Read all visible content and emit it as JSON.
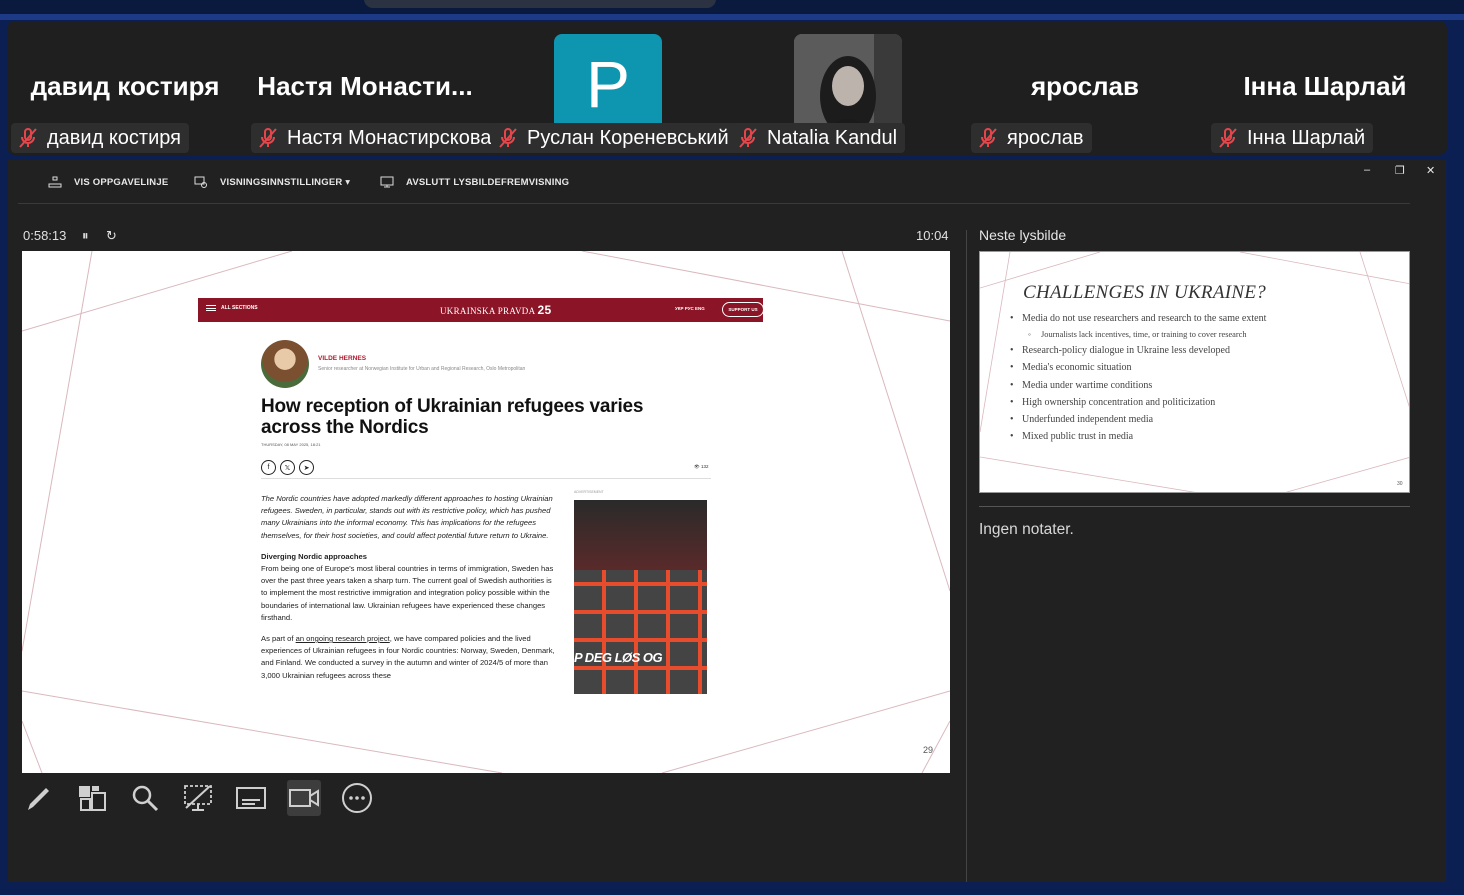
{
  "participants": [
    {
      "big_name": "давид костиря",
      "label": "давид костиря",
      "muted": true
    },
    {
      "big_name": "Настя  Монасти...",
      "label": "Настя Монастирскова",
      "muted": true
    },
    {
      "avatar_letter": "P",
      "label": "Руслан Кореневський",
      "muted": true
    },
    {
      "label": "Natalia Kandul",
      "muted": true,
      "has_video": true
    },
    {
      "big_name": "ярослав",
      "label": "ярослав",
      "muted": true
    },
    {
      "big_name": "Інна Шарлай",
      "label": "Інна Шарлай",
      "muted": true
    }
  ],
  "toolbar": {
    "show_taskbar": "VIS OPPGAVELINJE",
    "display_settings": "VISNINGSINNSTILLINGER ▾",
    "end_slideshow": "AVSLUTT LYSBILDEFREMVISNING",
    "win_min": "–",
    "win_restore": "❐",
    "win_close": "✕"
  },
  "presenter": {
    "elapsed": "0:58:13",
    "pause_icon": "⏸",
    "reset_icon": "↻",
    "clock": "10:04",
    "next_slide_label": "Neste lysbilde",
    "notes": "Ingen notater."
  },
  "current_slide": {
    "number": "29",
    "article": {
      "sections": "ALL SECTIONS",
      "brand": "UKRAINSKA PRAVDA",
      "brand_num": "25",
      "langs": "УКР   РУС   ENG",
      "support": "SUPPORT US",
      "author_name": "VILDE HERNES",
      "author_title": "Senior researcher at Norwegian Institute for Urban and Regional Research, Oslo Metropolitan",
      "headline": "How reception of Ukrainian refugees varies across the Nordics",
      "date": "THURSDAY, 08 MAY 2025, 18:21",
      "social": [
        "f",
        "𝕏",
        "➤"
      ],
      "views": "👁 132",
      "lead": "The Nordic countries have adopted markedly different approaches to hosting Ukrainian refugees. Sweden, in particular, stands out with its restrictive policy, which has pushed many Ukrainians into the informal economy. This has implications for the refugees themselves, for their host societies, and could affect potential future return to Ukraine.",
      "subheading": "Diverging Nordic approaches",
      "paragraph1": "From being one of Europe's most liberal countries in terms of immigration, Sweden has over the past three years taken a sharp turn. The current goal of Swedish authorities is to implement the most restrictive immigration and integration policy possible within the boundaries of international law. Ukrainian refugees have experienced these changes firsthand.",
      "p2_before": "As part of ",
      "p2_link": "an ongoing research project",
      "p2_after": ", we have compared policies and the lived experiences of Ukrainian refugees in four Nordic countries: Norway, Sweden, Denmark, and Finland. We conducted a survey in the autumn and winter of 2024/5 of more than 3,000 Ukrainian refugees across these",
      "ad_label": "ADVERTISEMENT",
      "ad_text": "P DEG LØS OG"
    }
  },
  "next_slide": {
    "title": "CHALLENGES IN UKRAINE?",
    "bullets": [
      {
        "text": "Media do not use researchers and research to the same extent",
        "sub": false
      },
      {
        "text": "Journalists lack incentives, time, or training to cover research",
        "sub": true
      },
      {
        "text": "Research-policy dialogue in Ukraine less developed",
        "sub": false
      },
      {
        "text": "Media's economic situation",
        "sub": false
      },
      {
        "text": "Media under wartime conditions",
        "sub": false
      },
      {
        "text": "High ownership concentration and politicization",
        "sub": false
      },
      {
        "text": "Underfunded independent media",
        "sub": false
      },
      {
        "text": "Mixed public trust in media",
        "sub": false
      }
    ],
    "number": "30"
  },
  "tools": [
    "pen-icon",
    "all-slides-icon",
    "zoom-icon",
    "black-screen-icon",
    "subtitles-icon",
    "camera-icon",
    "more-options-icon"
  ],
  "colors": {
    "accent_red": "#8b1426",
    "avatar_teal": "#0e95b0",
    "mute_red": "#e5464b"
  }
}
